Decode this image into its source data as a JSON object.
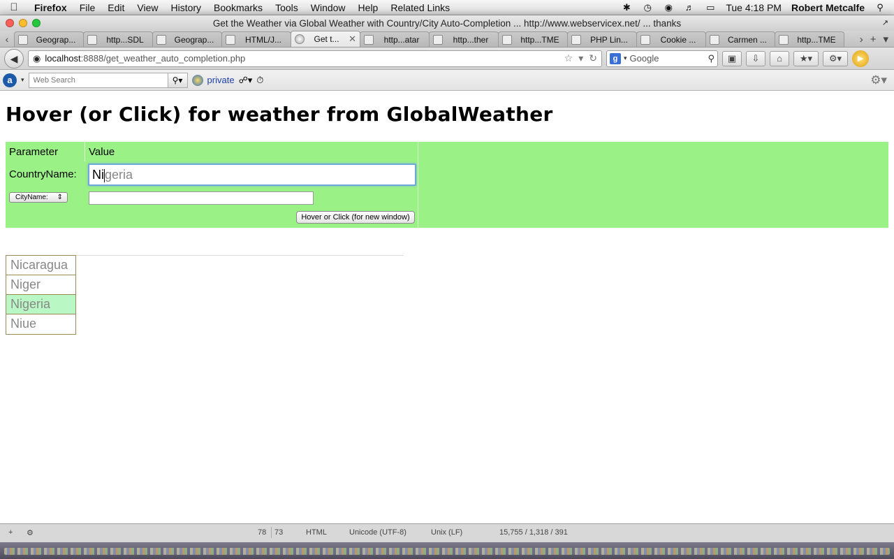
{
  "menubar": {
    "app": "Firefox",
    "items": [
      "File",
      "Edit",
      "View",
      "History",
      "Bookmarks",
      "Tools",
      "Window",
      "Help",
      "Related Links"
    ],
    "clock": "Tue 4:18 PM",
    "user": "Robert Metcalfe"
  },
  "window": {
    "title": "Get the Weather via Global Weather with Country/City Auto-Completion ... http://www.webservicex.net/ ... thanks"
  },
  "tabs": [
    {
      "label": "Geograp...",
      "active": false
    },
    {
      "label": "http...SDL",
      "active": false
    },
    {
      "label": "Geograp...",
      "active": false
    },
    {
      "label": "HTML/J...",
      "active": false
    },
    {
      "label": "Get t...",
      "active": true
    },
    {
      "label": "http...atar",
      "active": false
    },
    {
      "label": "http...ther",
      "active": false
    },
    {
      "label": "http...TME",
      "active": false
    },
    {
      "label": "PHP Lin...",
      "active": false
    },
    {
      "label": "Cookie ...",
      "active": false
    },
    {
      "label": "Carmen ...",
      "active": false
    },
    {
      "label": "http...TME",
      "active": false
    }
  ],
  "navbar": {
    "url_host": "localhost",
    "url_rest": ":8888/get_weather_auto_completion.php",
    "search_engine": "Google"
  },
  "addonbar": {
    "websearch_placeholder": "Web Search",
    "private_label": "private"
  },
  "page": {
    "title": "Hover (or Click) for weather from GlobalWeather",
    "table_headers": {
      "param": "Parameter",
      "value": "Value"
    },
    "country_label": "CountryName:",
    "country_typed": "Ni",
    "country_suggested_rest": "geria",
    "city_select": "CityName:",
    "city_value": "",
    "submit_label": "Hover or Click (for new window)",
    "panel_color": "#9af185"
  },
  "suggestions": [
    {
      "label": "Nicaragua",
      "highlighted": false
    },
    {
      "label": "Niger",
      "highlighted": false
    },
    {
      "label": "Nigeria",
      "highlighted": true
    },
    {
      "label": "Niue",
      "highlighted": false
    }
  ],
  "editor_status": {
    "line": "78",
    "col": "73",
    "mode": "HTML",
    "encoding": "Unicode (UTF-8)",
    "line_endings": "Unix (LF)",
    "stats": "15,755 / 1,318 / 391"
  }
}
